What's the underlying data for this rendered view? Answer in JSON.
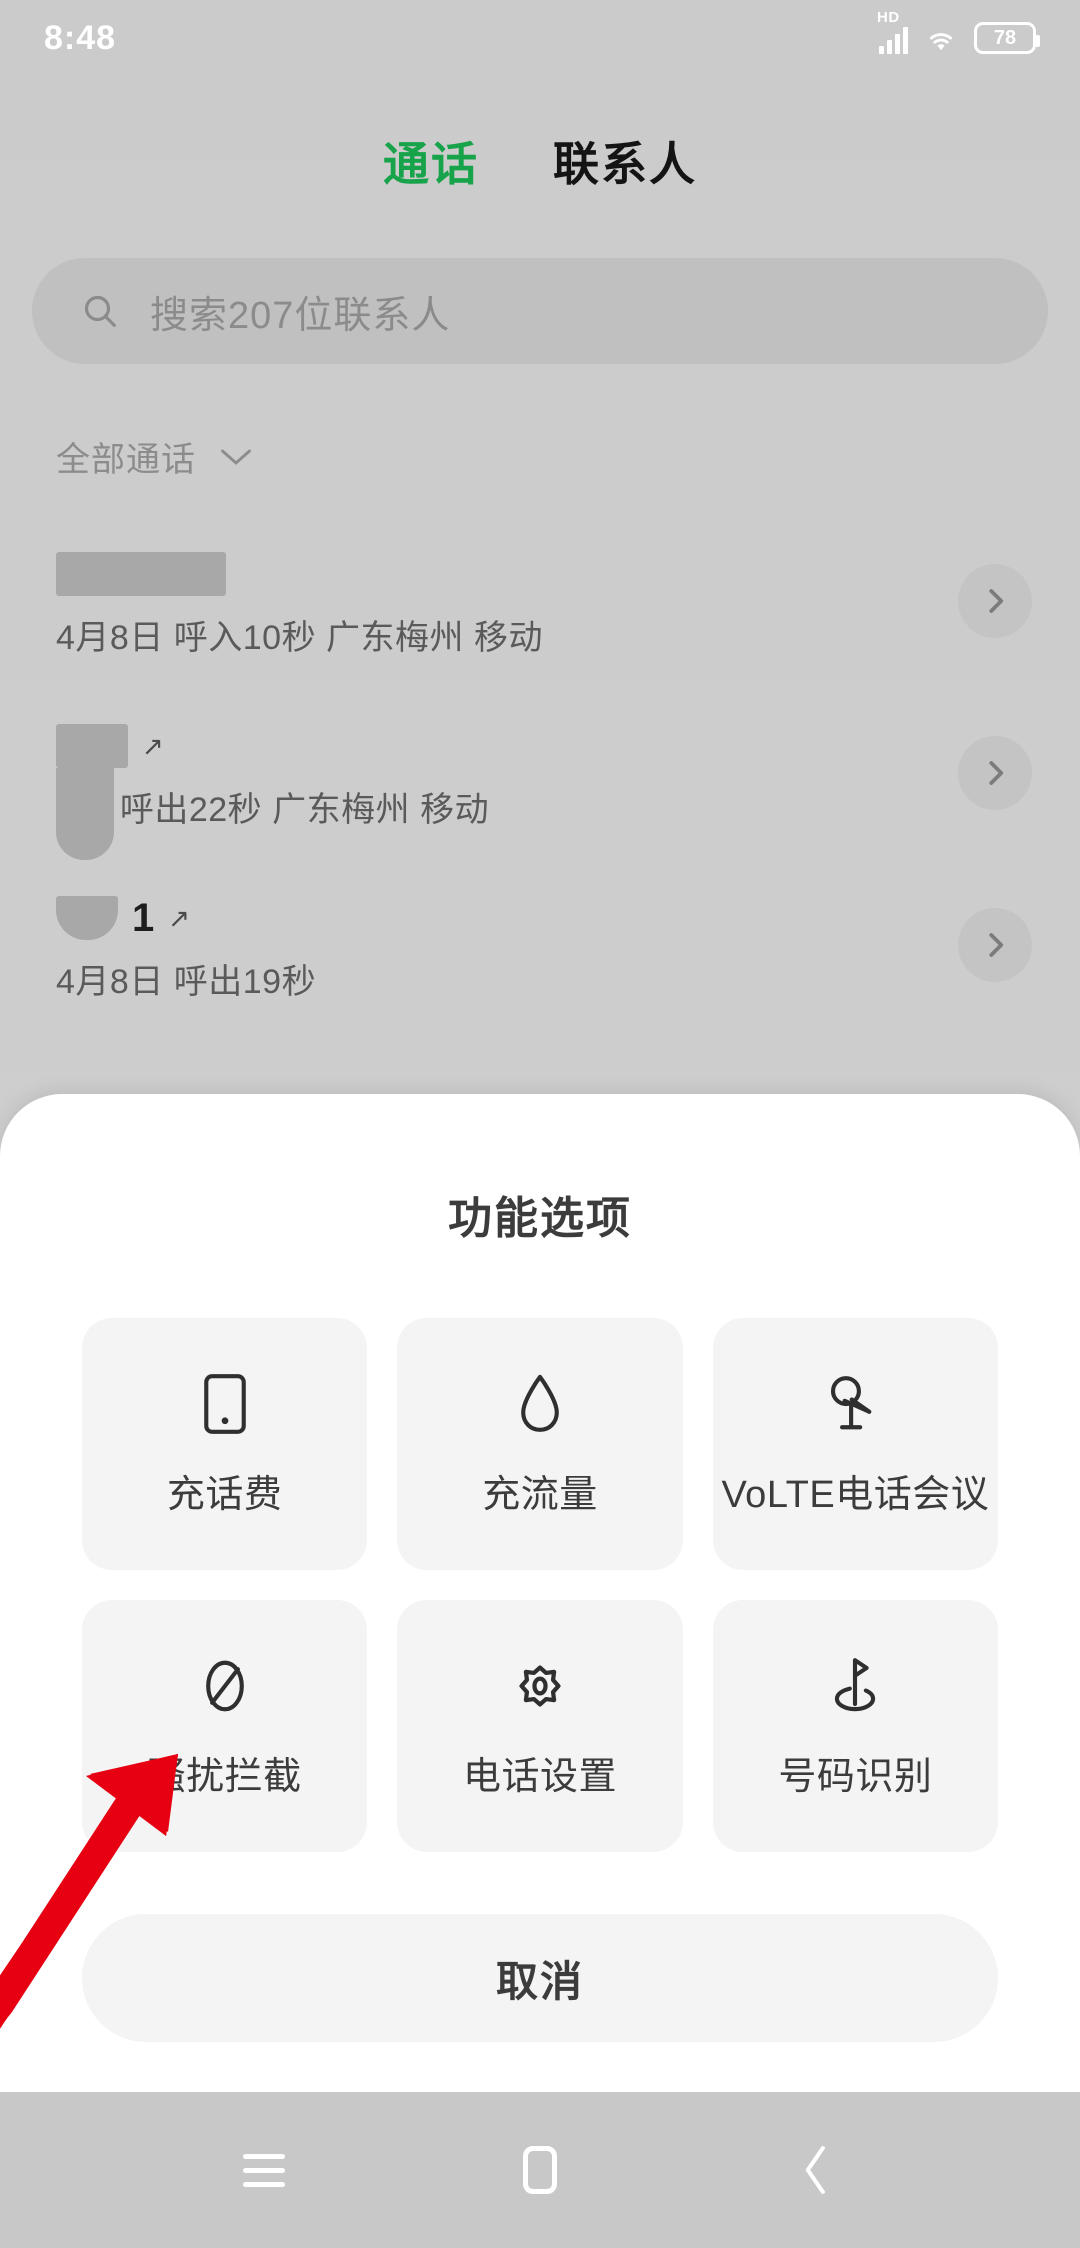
{
  "status_bar": {
    "time": "8:48",
    "hd_label": "HD",
    "battery_level": "78",
    "icons": [
      "hd-signal-icon",
      "wifi-icon",
      "battery-icon"
    ]
  },
  "tabs": [
    {
      "label": "通话",
      "active": true
    },
    {
      "label": "联系人",
      "active": false
    }
  ],
  "search": {
    "placeholder": "搜索207位联系人",
    "icon": "search-icon"
  },
  "filter": {
    "label": "全部通话",
    "icon": "chevron-down-icon"
  },
  "call_log": [
    {
      "name": "",
      "meta": "4月8日 呼入10秒 广东梅州 移动",
      "direction": "incoming",
      "redacted": true
    },
    {
      "name": "",
      "meta": "8日 呼出22秒 广东梅州 移动",
      "direction": "outgoing",
      "redacted": true
    },
    {
      "name": "1",
      "meta": "4月8日 呼出19秒",
      "direction": "outgoing",
      "redacted": true
    }
  ],
  "sheet": {
    "title": "功能选项",
    "options": [
      {
        "label": "充话费",
        "icon": "phone-bill-icon"
      },
      {
        "label": "充流量",
        "icon": "data-droplet-icon"
      },
      {
        "label": "VoLTE电话会议",
        "icon": "conference-call-icon"
      },
      {
        "label": "骚扰拦截",
        "icon": "block-icon"
      },
      {
        "label": "电话设置",
        "icon": "settings-gear-icon"
      },
      {
        "label": "号码识别",
        "icon": "number-id-flag-icon"
      }
    ],
    "cancel_label": "取消"
  },
  "annotation": {
    "color": "#e60012",
    "points_to": "骚扰拦截"
  },
  "nav_bar": {
    "buttons": [
      {
        "icon": "menu-icon"
      },
      {
        "icon": "home-icon"
      },
      {
        "icon": "back-icon"
      }
    ]
  },
  "colors": {
    "background": "#cdcdcd",
    "sheet": "#ffffff",
    "tile": "#f4f4f4",
    "accent_green": "#16a34a",
    "annotation_red": "#e60012"
  }
}
